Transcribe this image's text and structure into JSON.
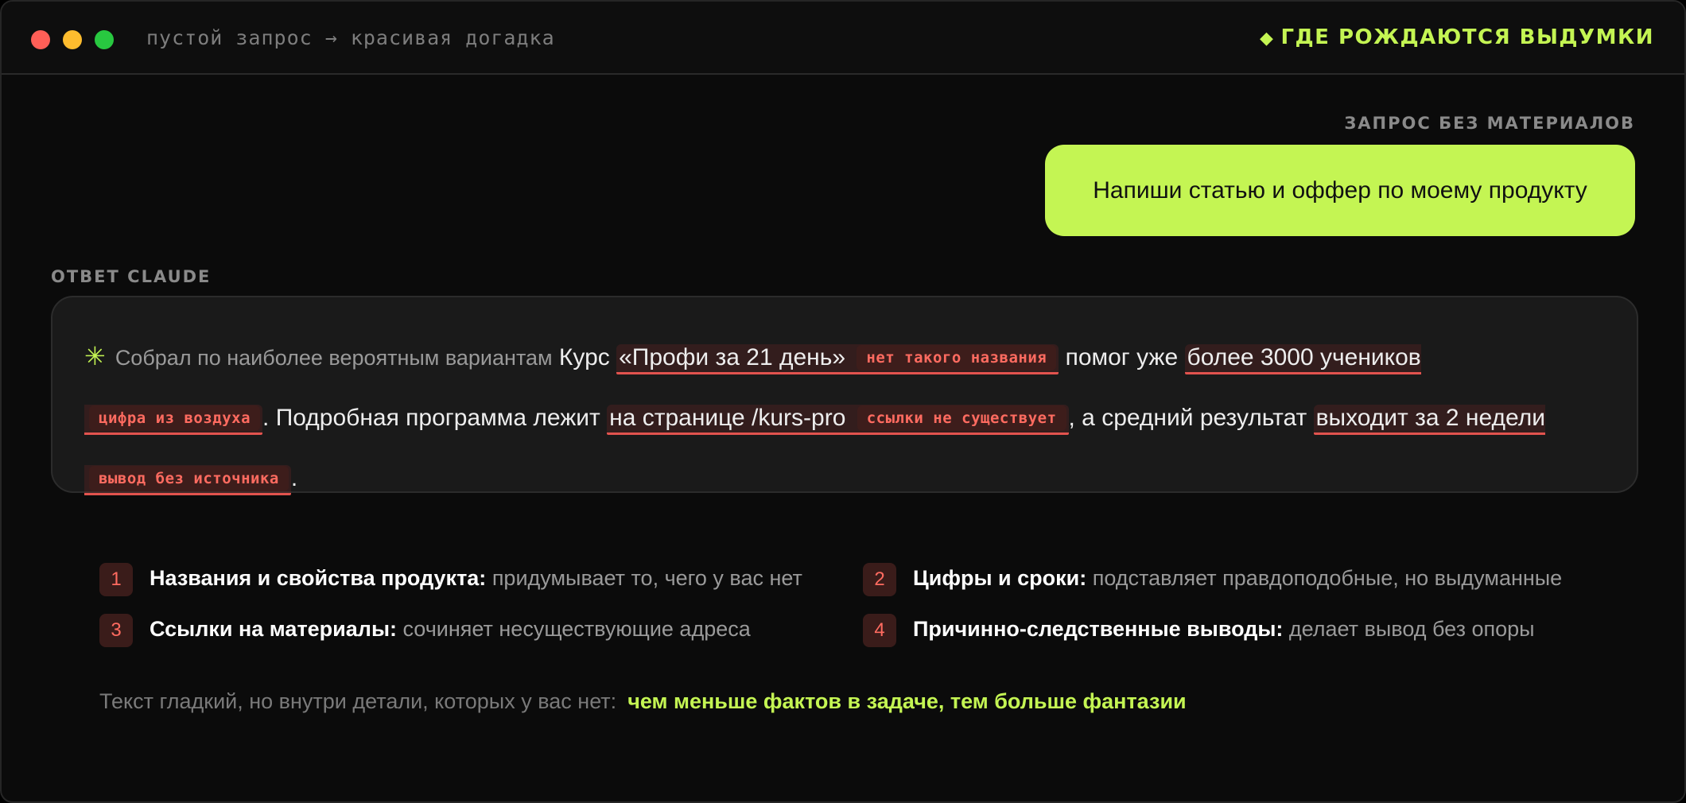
{
  "titlebar": {
    "crumb": "пустой запрос → красивая догадка",
    "brand_icon": "◆",
    "brand": "ГДЕ РОЖДАЮТСЯ ВЫДУМКИ"
  },
  "request": {
    "label": "ЗАПРОС БЕЗ МАТЕРИАЛОВ",
    "text": "Напиши статью и оффер по моему продукту"
  },
  "answer": {
    "label": "ОТВЕТ CLAUDE",
    "spark_icon": "✳",
    "intro": "Собрал по наиболее вероятным вариантам",
    "t1": " Курс ",
    "h1": "«Профи за 21 день»",
    "tag1": "нет такого названия",
    "t2": " помог уже ",
    "h2": "более 3000 учеников",
    "tag2": "цифра из воздуха",
    "t3": ". Подробная программа лежит ",
    "h3": "на странице /kurs-pro",
    "tag3": "ссылки не существует",
    "t4": ", а средний результат ",
    "h4": "выходит за 2 недели",
    "tag4": "вывод без источника",
    "t5": "."
  },
  "list": [
    {
      "num": "1",
      "bold": "Названия и свойства продукта:",
      "text": " придумывает то, чего у вас нет"
    },
    {
      "num": "2",
      "bold": "Цифры и сроки:",
      "text": " подставляет правдоподобные, но выдуманные"
    },
    {
      "num": "3",
      "bold": "Ссылки на материалы:",
      "text": " сочиняет несуществующие адреса"
    },
    {
      "num": "4",
      "bold": "Причинно-следственные выводы:",
      "text": " делает вывод без опоры"
    }
  ],
  "footer": {
    "text": "Текст гладкий, но внутри детали, которых у вас нет:",
    "accent": "чем меньше фактов в задаче, тем больше фантазии"
  },
  "colors": {
    "accent": "#c4f553",
    "warning": "#ff6b60",
    "background": "#0b0b0b"
  }
}
